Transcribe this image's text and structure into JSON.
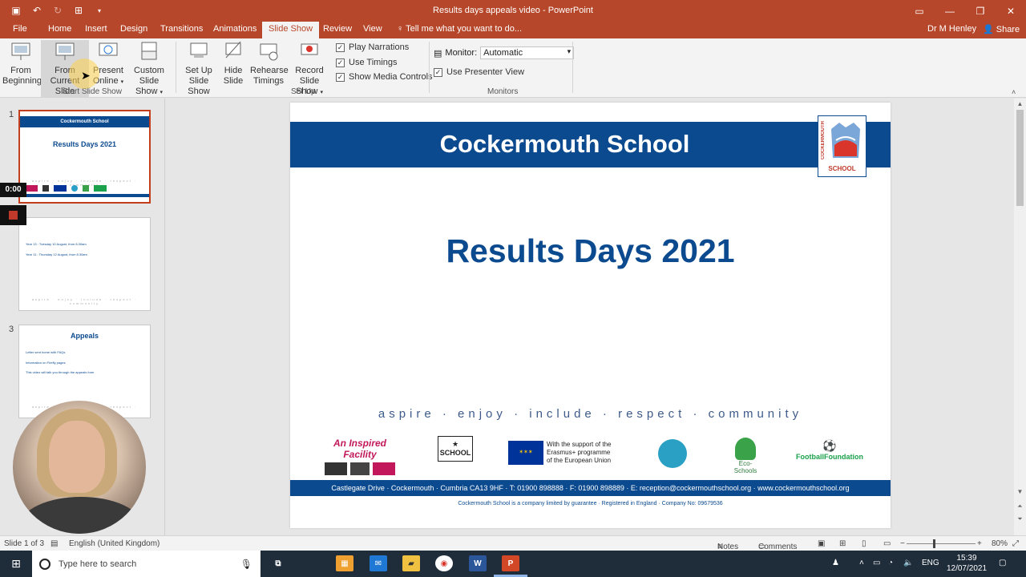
{
  "window": {
    "title": "Results days appeals video - PowerPoint"
  },
  "tabs": [
    "File",
    "Home",
    "Insert",
    "Design",
    "Transitions",
    "Animations",
    "Slide Show",
    "Review",
    "View"
  ],
  "active_tab": "Slide Show",
  "tellme": "Tell me what you want to do...",
  "user": "Dr M Henley",
  "share": "Share",
  "ribbon": {
    "from_beginning": [
      "From",
      "Beginning"
    ],
    "from_current": [
      "From",
      "Current Slide"
    ],
    "present_online": [
      "Present",
      "Online"
    ],
    "custom_show": [
      "Custom Slide",
      "Show"
    ],
    "setup": [
      "Set Up",
      "Slide Show"
    ],
    "hide": [
      "Hide",
      "Slide"
    ],
    "rehearse": [
      "Rehearse",
      "Timings"
    ],
    "record": [
      "Record Slide",
      "Show"
    ],
    "play_narrations": "Play Narrations",
    "use_timings": "Use Timings",
    "show_media_controls": "Show Media Controls",
    "monitor_label": "Monitor:",
    "monitor_value": "Automatic",
    "use_presenter_view": "Use Presenter View",
    "groups": {
      "start": "Start Slide Show",
      "setup": "Set Up",
      "monitors": "Monitors"
    }
  },
  "thumbnails": [
    {
      "num": "1",
      "band": "Cockermouth School",
      "title": "Results Days 2021"
    },
    {
      "num": "",
      "lines": [
        "Year 13 : Tuesday 10 August, from 8.30am",
        "Year 11 : Thursday 12 August, from 8.30am"
      ]
    },
    {
      "num": "3",
      "title": "Appeals",
      "lines": [
        "Letter sent home with FAQs",
        "Information on Firefly pages",
        "This video will talk you through the appeals form"
      ]
    }
  ],
  "recording": {
    "timer": "0:00"
  },
  "slide": {
    "school": "Cockermouth School",
    "logo_vertical": "COCKERMOUTH",
    "logo_text": "SCHOOL",
    "heading": "Results Days 2021",
    "motto": "aspire · enjoy · include · respect · community",
    "partners": {
      "inspired": "An Inspired Facility",
      "stonewall": "SCHOOL",
      "eu": [
        "With the support of the",
        "Erasmus+ programme",
        "of the European Union"
      ],
      "eco": "Eco-Schools",
      "football": "FootballFoundation"
    },
    "address": "Castlegate Drive · Cockermouth · Cumbria CA13 9HF · T: 01900 898888 · F: 01900 898889 · E: reception@cockermouthschool.org · www.cockermouthschool.org",
    "legal": "Cockermouth School is a company limited by guarantee · Registered in England · Company No: 09679536"
  },
  "status": {
    "slide_of": "Slide 1 of 3",
    "language": "English (United Kingdom)",
    "notes": "Notes",
    "comments": "Comments",
    "zoom": "80%"
  },
  "taskbar": {
    "search_placeholder": "Type here to search",
    "lang": "ENG",
    "time": "15:39",
    "date": "12/07/2021"
  },
  "colors": {
    "accent": "#b7472a",
    "school_blue": "#0b4a8f"
  }
}
